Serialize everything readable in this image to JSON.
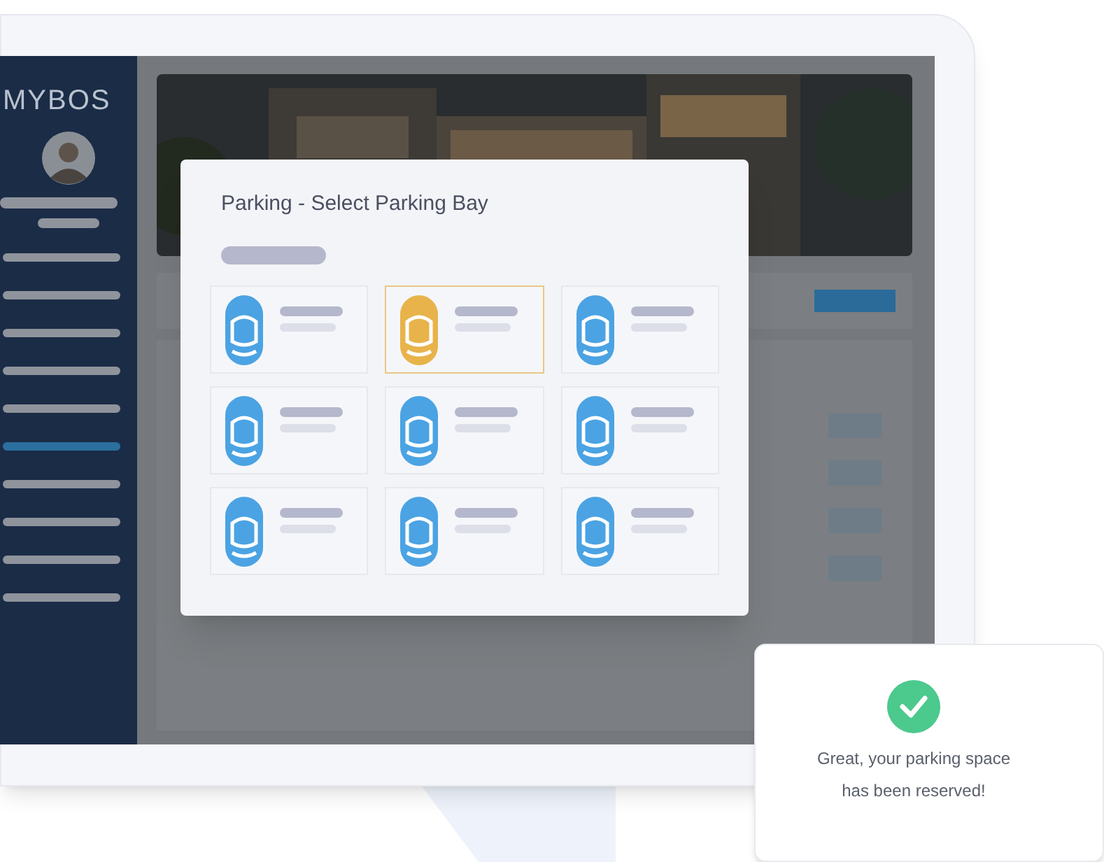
{
  "sidebar": {
    "logo": "MYBOS",
    "nav_items": [
      {
        "selected": false
      },
      {
        "selected": false
      },
      {
        "selected": false
      },
      {
        "selected": false
      },
      {
        "selected": false
      },
      {
        "selected": true
      },
      {
        "selected": false
      },
      {
        "selected": false
      },
      {
        "selected": false
      },
      {
        "selected": false
      }
    ]
  },
  "modal": {
    "title": "Parking - Select Parking Bay",
    "bays": [
      {
        "selected": false
      },
      {
        "selected": true
      },
      {
        "selected": false
      },
      {
        "selected": false
      },
      {
        "selected": false
      },
      {
        "selected": false
      },
      {
        "selected": false
      },
      {
        "selected": false
      },
      {
        "selected": false
      }
    ]
  },
  "toast": {
    "lines": [
      "Great, your parking space",
      "has been reserved!"
    ]
  }
}
